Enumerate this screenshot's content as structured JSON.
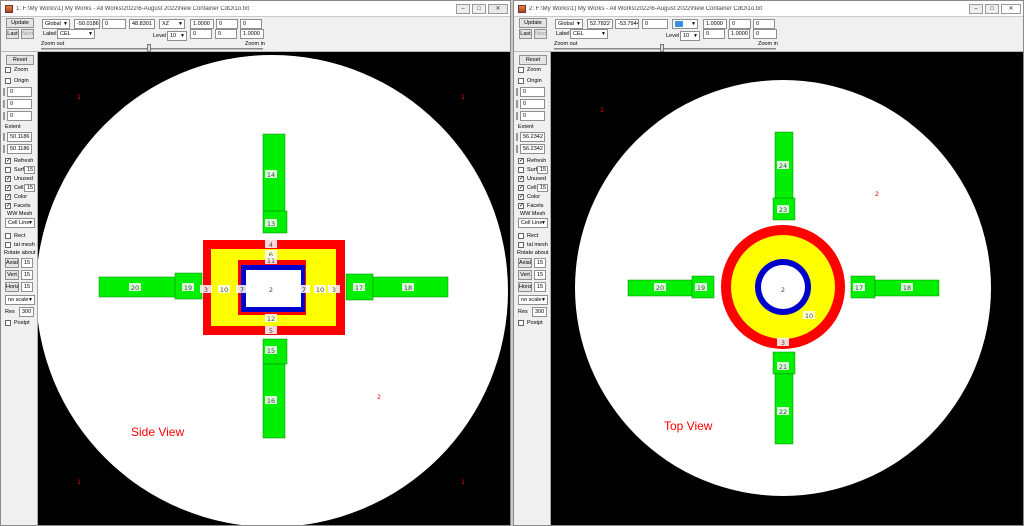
{
  "windows": [
    {
      "title": "1: F:\\My Works\\1) My Works - All Works\\2022\\6-August 2022\\New Container CdO\\1o.txt",
      "toolbar": {
        "update": "Update",
        "last": "Last",
        "next": "Next",
        "coord_system": "Global",
        "x": "-50.0186",
        "y": "0",
        "z": "48.8301",
        "view_plane": "XZ",
        "scale": "1.0000",
        "r1": "0",
        "r2": "0",
        "label_caption": "Label",
        "label_mode": "CEL",
        "level_caption": "Level",
        "level": "10",
        "l1": "0",
        "l2": "0",
        "l3": "1.0000",
        "zoom_out": "Zoom out",
        "zoom_in": "Zoom in"
      },
      "sidebar": {
        "reset": "Reset",
        "zoom": "Zoom",
        "origin": "Origin",
        "o1": "0",
        "o2": "0",
        "o3": "0",
        "extent_caption": "Extent",
        "extent1": "50.1186",
        "extent2": "50.1186",
        "refresh": "Refresh",
        "surf": "Surf",
        "surf_val": "15",
        "unused": "Unused",
        "cell": "Cell",
        "cell_val": "15",
        "color": "Color",
        "facets": "Facets",
        "ww_mesh": "WW Mesh",
        "cell_lines": "Cell Line",
        "rect": "Rect",
        "tal_mesh": "tal mesh",
        "rotate_about": "Rotate about",
        "axial": "Axial",
        "axial_val": "15",
        "vert": "Vert",
        "vert_val": "15",
        "horiz": "Horiz",
        "horiz_val": "15",
        "scale_mode": "no scale",
        "res": "Res",
        "res_val": "300",
        "postpt": "Postpt"
      },
      "view": {
        "caption": "Side View",
        "labels": [
          "1",
          "1",
          "1",
          "1",
          "2",
          "2",
          "3",
          "3",
          "4",
          "5",
          "6",
          "7",
          "7",
          "10",
          "10",
          "11",
          "12",
          "13",
          "14",
          "15",
          "16",
          "17",
          "18",
          "19",
          "20"
        ]
      }
    },
    {
      "title": "2: F:\\My Works\\1) My Works - All Works\\2022\\6-August 2022\\New Container CdO\\1o.txt",
      "toolbar": {
        "update": "Update",
        "last": "Last",
        "next": "Next",
        "coord_system": "Global",
        "x": "52.7822",
        "y": "-53.7944",
        "z": "0",
        "view_plane": "",
        "scale": "1.0000",
        "r1": "0",
        "r2": "0",
        "label_caption": "Label",
        "label_mode": "CEL",
        "level_caption": "Level",
        "level": "10",
        "l1": "0",
        "l2": "1.0000",
        "l3": "0",
        "zoom_out": "Zoom out",
        "zoom_in": "Zoom in"
      },
      "sidebar": {
        "reset": "Reset",
        "zoom": "Zoom",
        "origin": "Origin",
        "o1": "0",
        "o2": "0",
        "o3": "0",
        "extent_caption": "Extent",
        "extent1": "56.2342",
        "extent2": "56.2342",
        "refresh": "Refresh",
        "surf": "Surf",
        "surf_val": "15",
        "unused": "Unused",
        "cell": "Cell",
        "cell_val": "15",
        "color": "Color",
        "facets": "Facets",
        "ww_mesh": "WW Mesh",
        "cell_lines": "Cell Line",
        "rect": "Rect",
        "tal_mesh": "tal mesh",
        "rotate_about": "Rotate about",
        "axial": "Axial",
        "axial_val": "15",
        "vert": "Vert",
        "vert_val": "15",
        "horiz": "Horiz",
        "horiz_val": "15",
        "scale_mode": "no scale",
        "res": "Res",
        "res_val": "300",
        "postpt": "Postpt"
      },
      "view": {
        "caption": "Top View",
        "labels": [
          "1",
          "2",
          "2",
          "3",
          "10",
          "17",
          "18",
          "19",
          "20",
          "21",
          "22",
          "23",
          "24"
        ]
      }
    }
  ],
  "colors": {
    "void": "#000000",
    "world": "#ffffff",
    "red": "#ff0000",
    "yellow": "#ffff00",
    "blue": "#0000cc",
    "green": "#00ee00",
    "label": "#ff0000"
  }
}
